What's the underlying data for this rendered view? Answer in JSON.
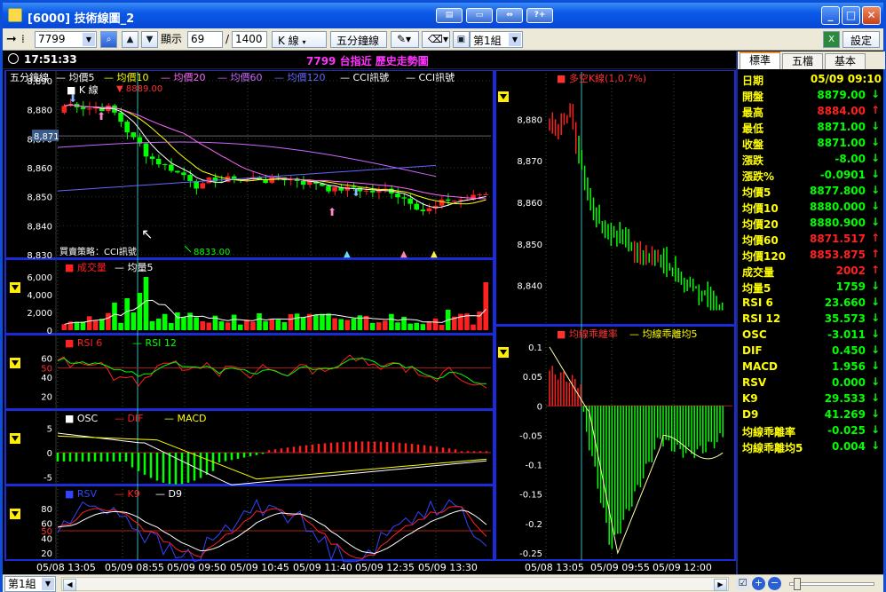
{
  "window": {
    "title": "[6000] 技術線圖_2",
    "minimize": "_",
    "maximize": "□",
    "close": "✕"
  },
  "toolbar": {
    "symbol": "7799",
    "display_label": "顯示",
    "range_start": "69",
    "range_sep": "/",
    "range_total": "1400",
    "kline_menu": "K 線",
    "period_menu": "五分鐘線",
    "group_menu": "第1組",
    "settings": "設定",
    "icons": [
      "arrow-right-icon",
      "grid-icon",
      "search-icon",
      "up-arrow-icon",
      "down-arrow-icon",
      "pencil-icon",
      "eraser-icon",
      "save-icon",
      "excel-icon"
    ]
  },
  "status": {
    "time": "17:51:33",
    "chart_title": "7799 台指近  歷史走勢圖"
  },
  "panels": {
    "main": {
      "legend": [
        "五分鐘線",
        "均價5",
        "均價10",
        "均價20",
        "均價60",
        "均價120",
        "CCI訊號",
        "CCI訊號"
      ],
      "legend2": "K 線",
      "high_label": "8889.00",
      "low_label": "8833.00",
      "current_label": "8,871",
      "strategy_label": "買賣策略：CCI訊號",
      "y_ticks": [
        "8,890",
        "8,880",
        "8,870",
        "8,860",
        "8,850",
        "8,840",
        "8,830"
      ]
    },
    "volume": {
      "legend": [
        "成交量",
        "均量5"
      ],
      "y_ticks": [
        "6,000",
        "4,000",
        "2,000",
        "0"
      ]
    },
    "rsi": {
      "legend": [
        "RSI 6",
        "RSI 12"
      ],
      "y_ticks": [
        "60",
        "50",
        "40",
        "20"
      ]
    },
    "macd": {
      "legend": [
        "OSC",
        "DIF",
        "MACD"
      ],
      "y_ticks": [
        "5",
        "0",
        "-5"
      ]
    },
    "kd": {
      "legend": [
        "RSV",
        "K9",
        "D9"
      ],
      "y_ticks": [
        "80",
        "60",
        "50",
        "40",
        "20"
      ]
    },
    "x_ticks": [
      "05/08 13:05",
      "05/09 08:55",
      "05/09 09:50",
      "05/09 10:45",
      "05/09 11:40",
      "05/09 12:35",
      "05/09 13:30"
    ],
    "right_top": {
      "legend": "多空K線(1,0.7%)",
      "y_ticks": [
        "8,880",
        "8,870",
        "8,860",
        "8,850",
        "8,840"
      ]
    },
    "right_bottom": {
      "legend": [
        "均線乖離率",
        "均線乖離均5"
      ],
      "y_ticks": [
        "0.1",
        "0.05",
        "0",
        "-0.05",
        "-0.1",
        "-0.15",
        "-0.2",
        "-0.25"
      ]
    },
    "right_x_ticks": [
      "05/08 13:05",
      "05/09 09:55",
      "05/09 12:00"
    ]
  },
  "sidebar": {
    "tabs": [
      "標準",
      "五檔",
      "基本"
    ],
    "rows": [
      {
        "label": "日期",
        "value": "05/09 09:10",
        "color": "#ffff00",
        "arrow": ""
      },
      {
        "label": "開盤",
        "value": "8879.00",
        "color": "#00ff00",
        "arrow": "↓"
      },
      {
        "label": "最高",
        "value": "8884.00",
        "color": "#ff2020",
        "arrow": "↑"
      },
      {
        "label": "最低",
        "value": "8871.00",
        "color": "#00ff00",
        "arrow": "↓"
      },
      {
        "label": "收盤",
        "value": "8871.00",
        "color": "#00ff00",
        "arrow": "↓"
      },
      {
        "label": "漲跌",
        "value": "-8.00",
        "color": "#00ff00",
        "arrow": "↓"
      },
      {
        "label": "漲跌%",
        "value": "-0.0901",
        "color": "#00ff00",
        "arrow": "↓"
      },
      {
        "label": "均價5",
        "value": "8877.800",
        "color": "#00ff00",
        "arrow": "↓"
      },
      {
        "label": "均價10",
        "value": "8880.000",
        "color": "#00ff00",
        "arrow": "↓"
      },
      {
        "label": "均價20",
        "value": "8880.900",
        "color": "#00ff00",
        "arrow": "↓"
      },
      {
        "label": "均價60",
        "value": "8871.517",
        "color": "#ff2020",
        "arrow": "↑"
      },
      {
        "label": "均價120",
        "value": "8853.875",
        "color": "#ff2020",
        "arrow": "↑"
      },
      {
        "label": "成交量",
        "value": "2002",
        "color": "#ff2020",
        "arrow": "↑"
      },
      {
        "label": "均量5",
        "value": "1759",
        "color": "#00ff00",
        "arrow": "↓"
      },
      {
        "label": "RSI 6",
        "value": "23.660",
        "color": "#00ff00",
        "arrow": "↓"
      },
      {
        "label": "RSI 12",
        "value": "35.573",
        "color": "#00ff00",
        "arrow": "↓"
      },
      {
        "label": "OSC",
        "value": "-3.011",
        "color": "#00ff00",
        "arrow": "↓"
      },
      {
        "label": "DIF",
        "value": "0.450",
        "color": "#00ff00",
        "arrow": "↓"
      },
      {
        "label": "MACD",
        "value": "1.956",
        "color": "#00ff00",
        "arrow": "↓"
      },
      {
        "label": "RSV",
        "value": "0.000",
        "color": "#00ff00",
        "arrow": "↓"
      },
      {
        "label": "K9",
        "value": "29.533",
        "color": "#00ff00",
        "arrow": "↓"
      },
      {
        "label": "D9",
        "value": "41.269",
        "color": "#00ff00",
        "arrow": "↓"
      },
      {
        "label": "均線乖離率",
        "value": "-0.025",
        "color": "#00ff00",
        "arrow": "↓"
      },
      {
        "label": "均線乖離均5",
        "value": "0.004",
        "color": "#00ff00",
        "arrow": "↓"
      }
    ]
  },
  "bottom": {
    "group_select": "第1組"
  },
  "colors": {
    "up": "#ff2020",
    "down": "#00ff00",
    "ma5": "#ffffff",
    "ma10": "#ffff00",
    "ma20": "#ff66ff",
    "ma60": "#cc66ff",
    "ma120": "#6666ff"
  }
}
